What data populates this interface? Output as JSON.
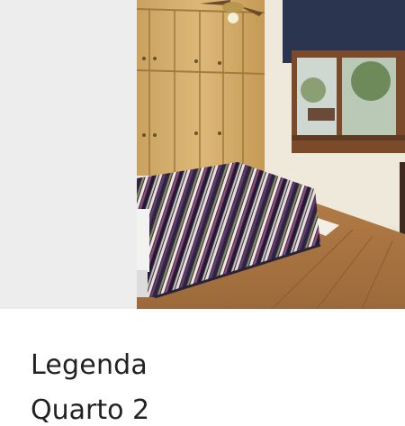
{
  "caption": {
    "title": "Legenda",
    "subtitle": "Quarto 2"
  },
  "photo": {
    "subject": "bedroom-photo"
  },
  "colors": {
    "left_pane": "#ededed",
    "caption_text": "#222222"
  }
}
